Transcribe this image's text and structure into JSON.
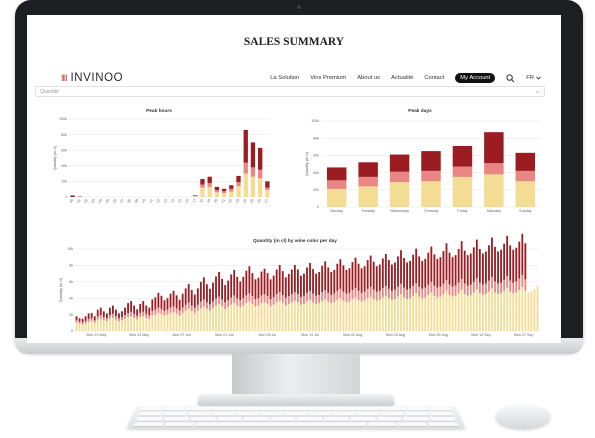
{
  "page_title": "SALES SUMMARY",
  "brand": {
    "name": "INVINOO"
  },
  "nav": {
    "links": [
      "La Solution",
      "Vins Premium",
      "About us",
      "Actualité",
      "Contact"
    ],
    "account_label": "My Account",
    "lang": "FR"
  },
  "filter": {
    "value": "Quantité"
  },
  "colors": {
    "dark": "#9b1c21",
    "mid": "#e98683",
    "light": "#f3dc93",
    "grid": "#e5e5e5"
  },
  "chart_data": [
    {
      "type": "bar",
      "stacked": true,
      "title": "Peak hours",
      "ylabel": "Quantity (in cl)",
      "ylim": [
        0,
        100000
      ],
      "yticks": [
        "0",
        "20k",
        "40k",
        "60k",
        "80k",
        "100k"
      ],
      "yvalues": [
        0,
        20000,
        40000,
        60000,
        80000,
        100000
      ],
      "categories": [
        "00",
        "01",
        "02",
        "03",
        "04",
        "05",
        "06",
        "07",
        "08",
        "09",
        "10",
        "11",
        "12",
        "13",
        "14",
        "15",
        "16",
        "17",
        "18",
        "19",
        "20",
        "21",
        "22",
        "23",
        "24",
        "25",
        "26",
        "27"
      ],
      "series": [
        {
          "values": [
            0,
            0,
            0,
            0,
            0,
            0,
            0,
            0,
            0,
            0,
            0,
            0,
            0,
            0,
            0,
            0,
            0,
            1000,
            12000,
            13000,
            6000,
            5000,
            7000,
            14000,
            30000,
            26000,
            24000,
            9000
          ]
        },
        {
          "values": [
            0,
            0,
            0,
            0,
            0,
            0,
            0,
            0,
            0,
            0,
            0,
            0,
            0,
            0,
            0,
            0,
            0,
            800,
            4000,
            5000,
            3000,
            2500,
            3500,
            5000,
            14000,
            12000,
            11000,
            3000
          ]
        },
        {
          "values": [
            2000,
            500,
            0,
            0,
            0,
            0,
            0,
            0,
            0,
            0,
            0,
            0,
            0,
            0,
            0,
            0,
            0,
            600,
            7000,
            8000,
            4000,
            3000,
            4500,
            8000,
            42000,
            32000,
            28000,
            8000
          ]
        }
      ]
    },
    {
      "type": "bar",
      "stacked": true,
      "title": "Peak days",
      "ylabel": "Quantity (in cl)",
      "ylim": [
        0,
        100000
      ],
      "yticks": [
        "0",
        "20k",
        "40k",
        "60k",
        "80k",
        "100k"
      ],
      "yvalues": [
        0,
        20000,
        40000,
        60000,
        80000,
        100000
      ],
      "categories": [
        "Monday",
        "Tuesday",
        "Wednesday",
        "Thursday",
        "Friday",
        "Saturday",
        "Sunday"
      ],
      "series": [
        {
          "values": [
            21000,
            24000,
            29000,
            30000,
            35000,
            38000,
            30000
          ]
        },
        {
          "values": [
            10000,
            11000,
            12000,
            12000,
            12000,
            13000,
            12000
          ]
        },
        {
          "values": [
            15000,
            17000,
            20000,
            23000,
            24000,
            36000,
            21000
          ]
        }
      ]
    },
    {
      "type": "bar",
      "stacked": true,
      "title": "Quantity (in cl) by wine color per day",
      "ylabel": "Quantity (in cl)",
      "ylim": [
        0,
        10000
      ],
      "yticks": [
        "0",
        "2k",
        "4k",
        "6k",
        "8k",
        "10k"
      ],
      "yvalues": [
        0,
        2000,
        4000,
        6000,
        8000,
        10000
      ],
      "xticks": [
        "Mon 10 May",
        "Mon 24 May",
        "Mon 07 Jun",
        "Mon 21 Jun",
        "Mon 05 Jul",
        "Mon 19 Jul",
        "Mon 02 Aug",
        "Mon 16 Aug",
        "Mon 30 Aug",
        "Mon 13 Sep",
        "Mon 27 Sep"
      ],
      "x_start": "2021-05-03",
      "x_end": "2021-10-02",
      "series": [
        {
          "values": [
            1000,
            900,
            800,
            900,
            1100,
            1200,
            1000,
            1400,
            1500,
            1300,
            1200,
            1500,
            1600,
            1400,
            1200,
            1300,
            1500,
            1700,
            1800,
            1600,
            1400,
            1700,
            1800,
            1600,
            1500,
            1900,
            2000,
            2200,
            2100,
            1900,
            2000,
            2200,
            2300,
            2100,
            1900,
            2200,
            2500,
            2700,
            2400,
            2200,
            2500,
            2800,
            3000,
            2700,
            2500,
            2800,
            3100,
            3300,
            3000,
            2700,
            2900,
            3200,
            3400,
            3100,
            2900,
            3100,
            3400,
            3600,
            3300,
            3000,
            3100,
            3400,
            3500,
            3300,
            3000,
            3200,
            3500,
            3700,
            3400,
            3100,
            3300,
            3500,
            3700,
            3500,
            3200,
            3300,
            3600,
            3800,
            3500,
            3300,
            3400,
            3700,
            3900,
            3600,
            3400,
            3500,
            3800,
            4000,
            3700,
            3500,
            3600,
            3900,
            4100,
            3800,
            3600,
            3700,
            4000,
            4200,
            3900,
            3700,
            3800,
            4100,
            4300,
            4000,
            3800,
            3900,
            4200,
            4500,
            4100,
            3900,
            4000,
            4300,
            4600,
            4200,
            4000,
            4100,
            4400,
            4700,
            4300,
            4100,
            4200,
            4500,
            4900,
            4400,
            4200,
            4300,
            4600,
            5000,
            4500,
            4300,
            4400,
            4700,
            5100,
            4600,
            4400,
            4500,
            4800,
            5200,
            4700,
            4500,
            4600,
            4900,
            5300,
            4800,
            4600,
            4700,
            5000,
            5400,
            4900,
            4700,
            4800,
            5100,
            5500
          ]
        },
        {
          "values": [
            300,
            250,
            250,
            300,
            350,
            350,
            300,
            400,
            450,
            400,
            350,
            450,
            500,
            400,
            350,
            400,
            450,
            500,
            550,
            500,
            450,
            500,
            550,
            500,
            450,
            550,
            600,
            650,
            600,
            550,
            600,
            650,
            700,
            650,
            600,
            650,
            700,
            750,
            700,
            650,
            700,
            800,
            850,
            800,
            750,
            800,
            850,
            900,
            850,
            800,
            850,
            900,
            950,
            900,
            850,
            900,
            950,
            1000,
            950,
            900,
            900,
            950,
            1000,
            950,
            900,
            950,
            1000,
            1050,
            1000,
            950,
            950,
            1000,
            1050,
            1000,
            950,
            1000,
            1050,
            1100,
            1050,
            1000,
            1000,
            1050,
            1100,
            1050,
            1000,
            1050,
            1100,
            1150,
            1100,
            1050,
            1050,
            1100,
            1150,
            1100,
            1050,
            1100,
            1150,
            1200,
            1150,
            1100,
            1100,
            1150,
            1200,
            1150,
            1100,
            1150,
            1200,
            1250,
            1200,
            1150,
            1150,
            1200,
            1250,
            1200,
            1150,
            1200,
            1250,
            1300,
            1250,
            1200,
            1200,
            1250,
            1300,
            1250,
            1200,
            1250,
            1300,
            1350,
            1300,
            1250,
            1250,
            1300,
            1350,
            1300,
            1250,
            1300,
            1350,
            1400,
            1350,
            1300,
            1300,
            1350,
            1400,
            1350,
            1300,
            1350,
            1400,
            1450,
            1400
          ]
        },
        {
          "values": [
            500,
            400,
            450,
            600,
            700,
            650,
            500,
            800,
            900,
            700,
            600,
            900,
            1000,
            800,
            600,
            700,
            900,
            1200,
            1300,
            1000,
            800,
            1100,
            1300,
            1000,
            900,
            1400,
            1500,
            1800,
            1600,
            1300,
            1400,
            1700,
            1900,
            1600,
            1300,
            1700,
            2000,
            2300,
            1900,
            1600,
            2000,
            2400,
            2700,
            2200,
            1900,
            2300,
            2700,
            3000,
            2500,
            2100,
            2400,
            2800,
            3100,
            2600,
            2300,
            2600,
            3000,
            3300,
            2800,
            2400,
            2500,
            2900,
            3100,
            2800,
            2400,
            2600,
            3000,
            3300,
            2900,
            2500,
            2700,
            3000,
            3300,
            3000,
            2600,
            2700,
            3100,
            3400,
            3000,
            2700,
            2800,
            3200,
            3500,
            3100,
            2800,
            2900,
            3300,
            3600,
            3200,
            2900,
            3000,
            3400,
            3700,
            3300,
            3000,
            3100,
            3500,
            3800,
            3400,
            3100,
            3200,
            3600,
            3900,
            3500,
            3200,
            3300,
            3700,
            4100,
            3600,
            3300,
            3400,
            3800,
            4200,
            3700,
            3400,
            3500,
            3900,
            4300,
            3800,
            3500,
            3600,
            4000,
            4500,
            3900,
            3600,
            3700,
            4100,
            4600,
            4000,
            3700,
            3800,
            4200,
            4700,
            4100,
            3800,
            3900,
            4300,
            4800,
            4200,
            3900,
            4000,
            4400,
            4900,
            4300,
            4000,
            4100,
            4500,
            5000,
            4400,
            4100,
            4200,
            4600,
            5100
          ]
        }
      ]
    }
  ]
}
